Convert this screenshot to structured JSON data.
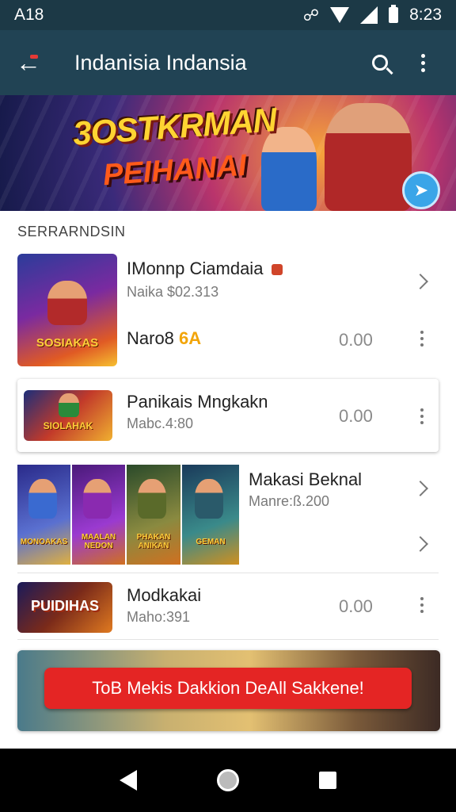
{
  "status_bar": {
    "left_text": "A18",
    "time": "8:23"
  },
  "app_bar": {
    "title": "Indanisia Indansia"
  },
  "banner": {
    "headline_1": "3OSTKRMAN",
    "headline_2": "PEIHANAI"
  },
  "section": {
    "label": "SERRARNDSIN"
  },
  "items": [
    {
      "title": "IMonnp Ciamdaia",
      "subtitle": "Naika $02.313",
      "thumb_text": "SOSIAKAS"
    },
    {
      "title_prefix": "Naro8",
      "title_badge": "6A",
      "price": "0.00"
    },
    {
      "title": "Panikais Mngkakn",
      "subtitle": "Mabc.4:80",
      "price": "0.00",
      "thumb_text": "SIOLAHAK"
    },
    {
      "title": "Makasi Beknal",
      "subtitle": "Manre:ß.200",
      "thumb_texts": [
        "MONOAKAS",
        "MAALAN NEDON",
        "PHAKAN ANIKAN",
        "GEMAN"
      ]
    },
    {
      "title": "Modkakai",
      "subtitle": "Maho:391",
      "price": "0.00",
      "thumb_text": "PUIDIHAS"
    }
  ],
  "promo": {
    "button_label": "ToB Mekis Dakkion DeAll Sakkene!"
  },
  "colors": {
    "app_bar": "#214354",
    "status_bar": "#1c3946",
    "promo_button": "#e42524",
    "badge_orange": "#f2a50a"
  },
  "icons": {
    "back": "arrow-left-icon",
    "search": "search-icon",
    "overflow": "more-vert-icon",
    "banner_badge": "location-pin-icon"
  }
}
